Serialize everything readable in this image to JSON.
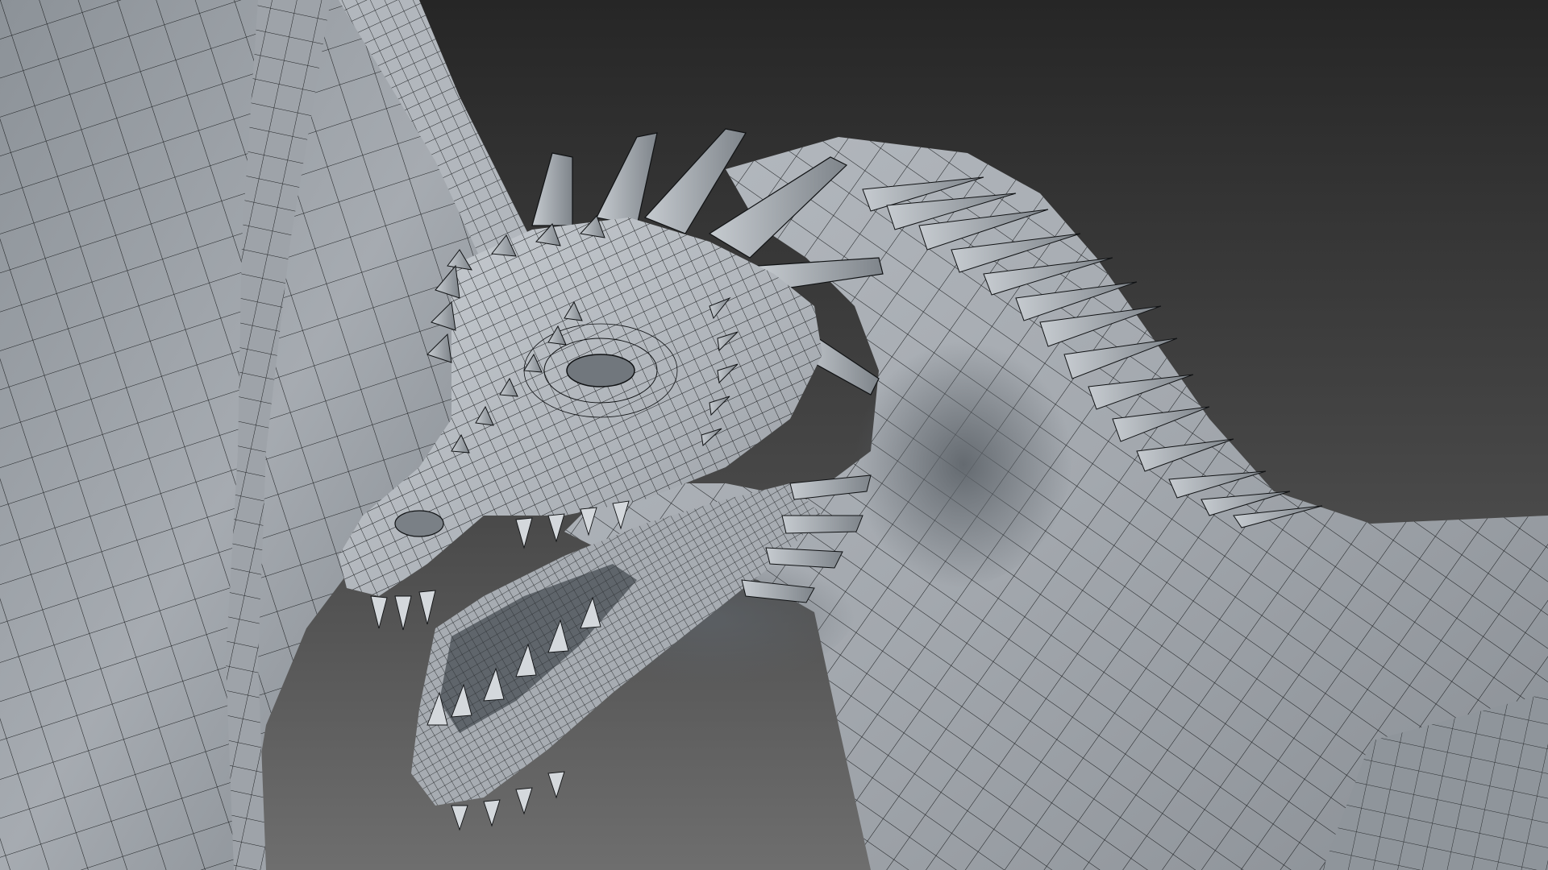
{
  "scene": {
    "subject": "dragon-wireframe-render",
    "colors": {
      "background_top": "#262626",
      "background_bottom": "#6e6e6e",
      "mesh_surface": "#a9aeb4",
      "mesh_highlight": "#c9ced3",
      "mesh_shadow": "#5d6369",
      "wire": "#101214"
    },
    "icons": {
      "model": "dragon-model-icon",
      "wing": "wing-membrane-icon",
      "head": "dragon-head-icon"
    }
  }
}
